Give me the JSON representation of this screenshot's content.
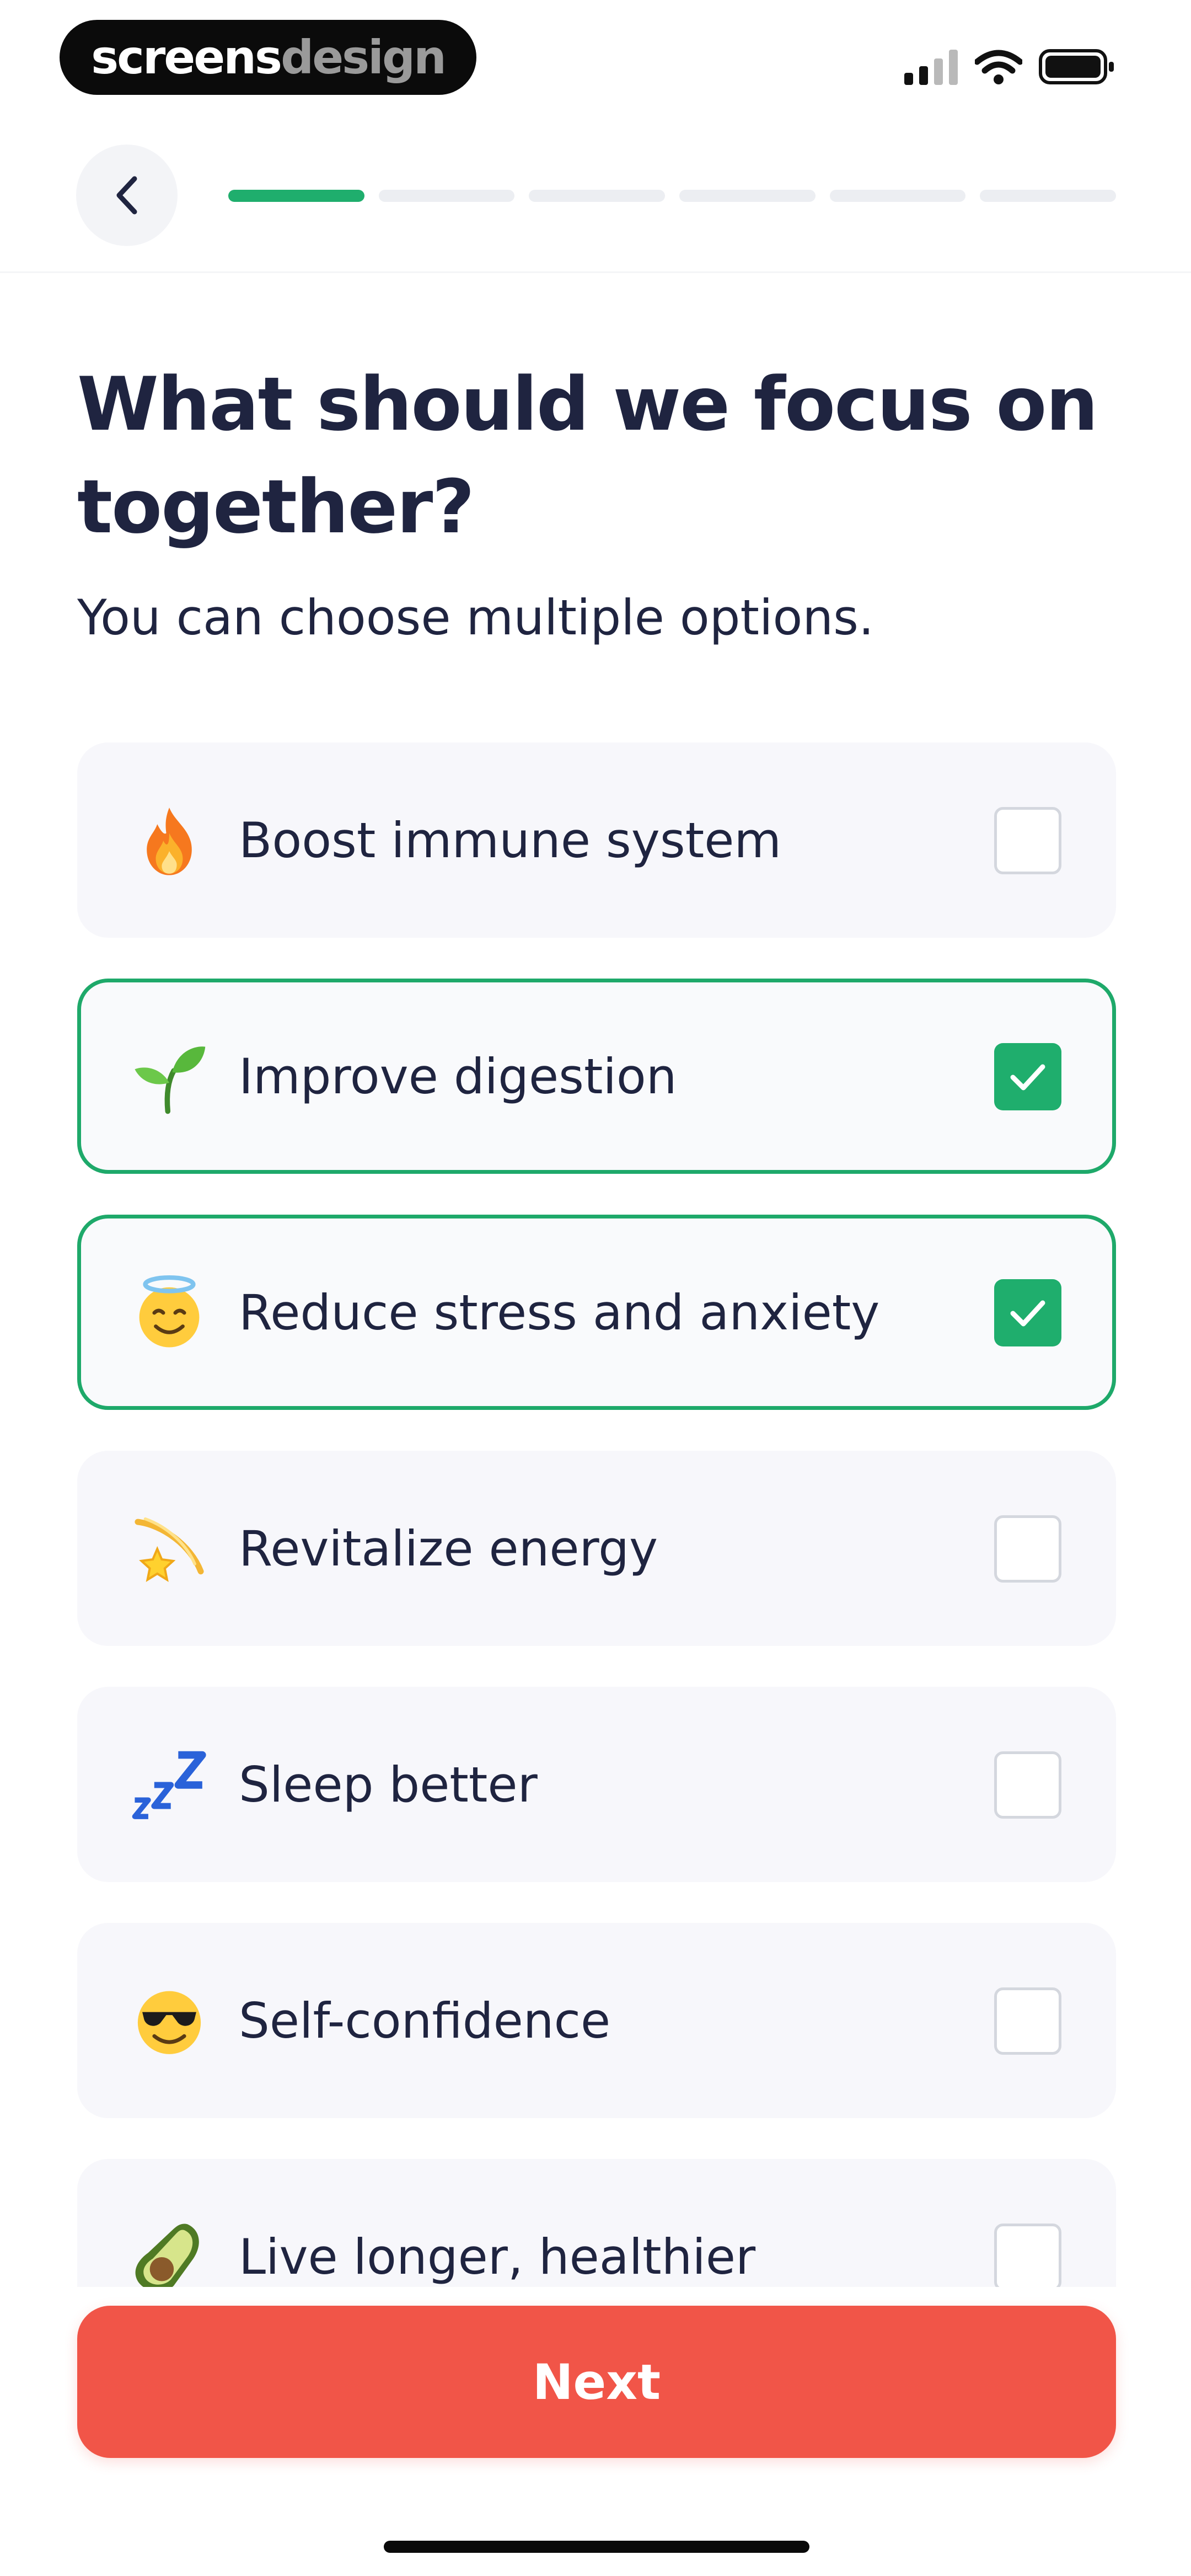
{
  "status_bar": {
    "brand_part1": "screens",
    "brand_part2": "design"
  },
  "progress": {
    "total_steps": 6,
    "completed_steps": 1
  },
  "header": {
    "title": "What should we focus on together?",
    "subtitle": "You can choose multiple options."
  },
  "options": [
    {
      "label": "Boost immune system",
      "icon": "fire-icon",
      "selected": false
    },
    {
      "label": "Improve digestion",
      "icon": "seedling-icon",
      "selected": true
    },
    {
      "label": "Reduce stress and anxiety",
      "icon": "smiling-face-with-halo-icon",
      "selected": true
    },
    {
      "label": "Revitalize energy",
      "icon": "dizzy-star-icon",
      "selected": false
    },
    {
      "label": "Sleep better",
      "icon": "zzz-icon",
      "selected": false
    },
    {
      "label": "Self-confidence",
      "icon": "smiling-face-with-sunglasses-icon",
      "selected": false
    },
    {
      "label": "Live longer, healthier",
      "icon": "avocado-icon",
      "selected": false
    }
  ],
  "next_button": {
    "label": "Next"
  },
  "colors": {
    "accent_green": "#1fae6d",
    "next_button": "#f15548",
    "title_text": "#1f2440",
    "option_background": "#f7f7fb"
  }
}
